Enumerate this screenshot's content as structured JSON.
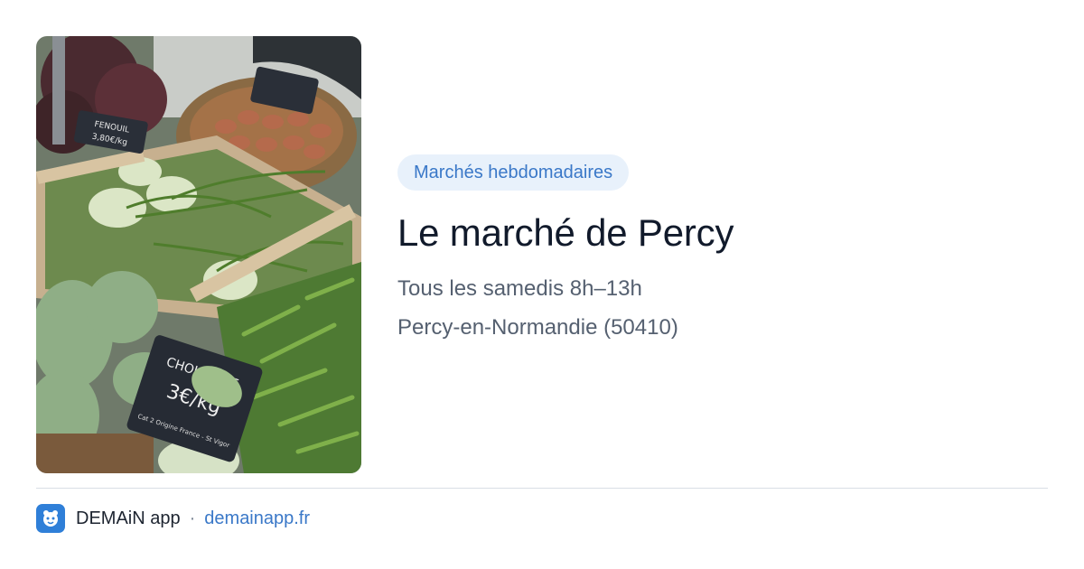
{
  "card": {
    "photo_alt": "Étal de légumes au marché",
    "chalkboards": {
      "fenouil_label": "FENOUIL",
      "fenouil_price": "3,80€/kg",
      "chou_label": "CHOU-RAVE",
      "chou_price": "3€/kg",
      "chou_note": "Cat 2 Origine France - St Vigor"
    },
    "category": "Marchés hebdomadaires",
    "title": "Le marché de Percy",
    "schedule": "Tous les samedis 8h–13h",
    "location": "Percy-en-Normandie (50410)"
  },
  "footer": {
    "brand": "DEMAiN app",
    "separator": "·",
    "url": "demainapp.fr"
  },
  "colors": {
    "badge_bg": "#e8f1fb",
    "accent": "#3a78c8",
    "title": "#111a2b",
    "meta": "#556070",
    "logo_bg": "#2f7fd8"
  }
}
